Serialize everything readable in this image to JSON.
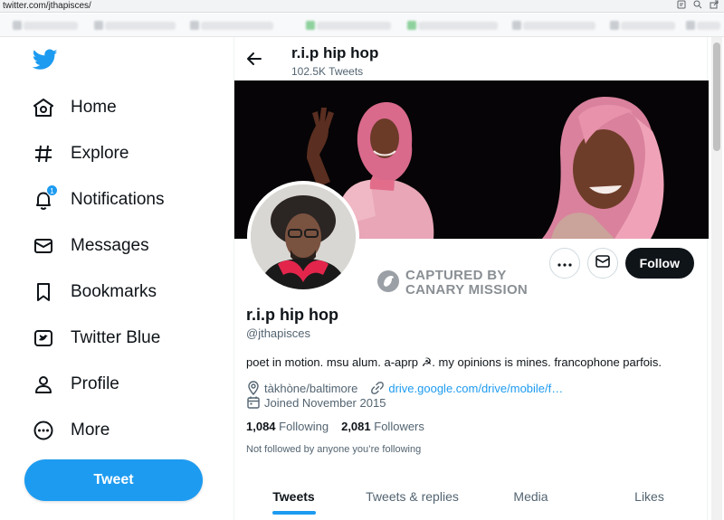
{
  "browser": {
    "url": "twitter.com/jthapisces/",
    "tool_icons": [
      "reader-icon",
      "zoom-icon",
      "share-icon"
    ]
  },
  "sidebar": {
    "logo": "twitter-bird-icon",
    "items": [
      {
        "label": "Home",
        "icon": "home-icon"
      },
      {
        "label": "Explore",
        "icon": "hashtag-icon"
      },
      {
        "label": "Notifications",
        "icon": "bell-icon",
        "badge": "1"
      },
      {
        "label": "Messages",
        "icon": "envelope-icon"
      },
      {
        "label": "Bookmarks",
        "icon": "bookmark-icon"
      },
      {
        "label": "Twitter Blue",
        "icon": "twitter-blue-icon"
      },
      {
        "label": "Profile",
        "icon": "person-icon"
      },
      {
        "label": "More",
        "icon": "more-circle-icon"
      }
    ],
    "tweet_button": "Tweet"
  },
  "header": {
    "name": "r.i.p hip hop",
    "tweet_count": "102.5K Tweets"
  },
  "profile": {
    "name": "r.i.p hip hop",
    "handle": "@jthapisces",
    "bio": "poet in motion. msu alum. a-aprp ☭. my opinions is mines. francophone parfois.",
    "location": "tàkhòne/baltimore",
    "link": "drive.google.com/drive/mobile/f…",
    "joined": "Joined November 2015",
    "following_count": "1,084",
    "following_label": "Following",
    "followers_count": "2,081",
    "followers_label": "Followers",
    "not_followed": "Not followed by anyone you’re following",
    "follow_button": "Follow"
  },
  "watermark": {
    "line1": "CAPTURED BY",
    "line2": "CANARY MISSION"
  },
  "tabs": [
    {
      "label": "Tweets",
      "active": true
    },
    {
      "label": "Tweets & replies",
      "active": false
    },
    {
      "label": "Media",
      "active": false
    },
    {
      "label": "Likes",
      "active": false
    }
  ],
  "colors": {
    "accent": "#1d9bf0",
    "follow_button": "#0f1419",
    "secondary_text": "#536471"
  }
}
